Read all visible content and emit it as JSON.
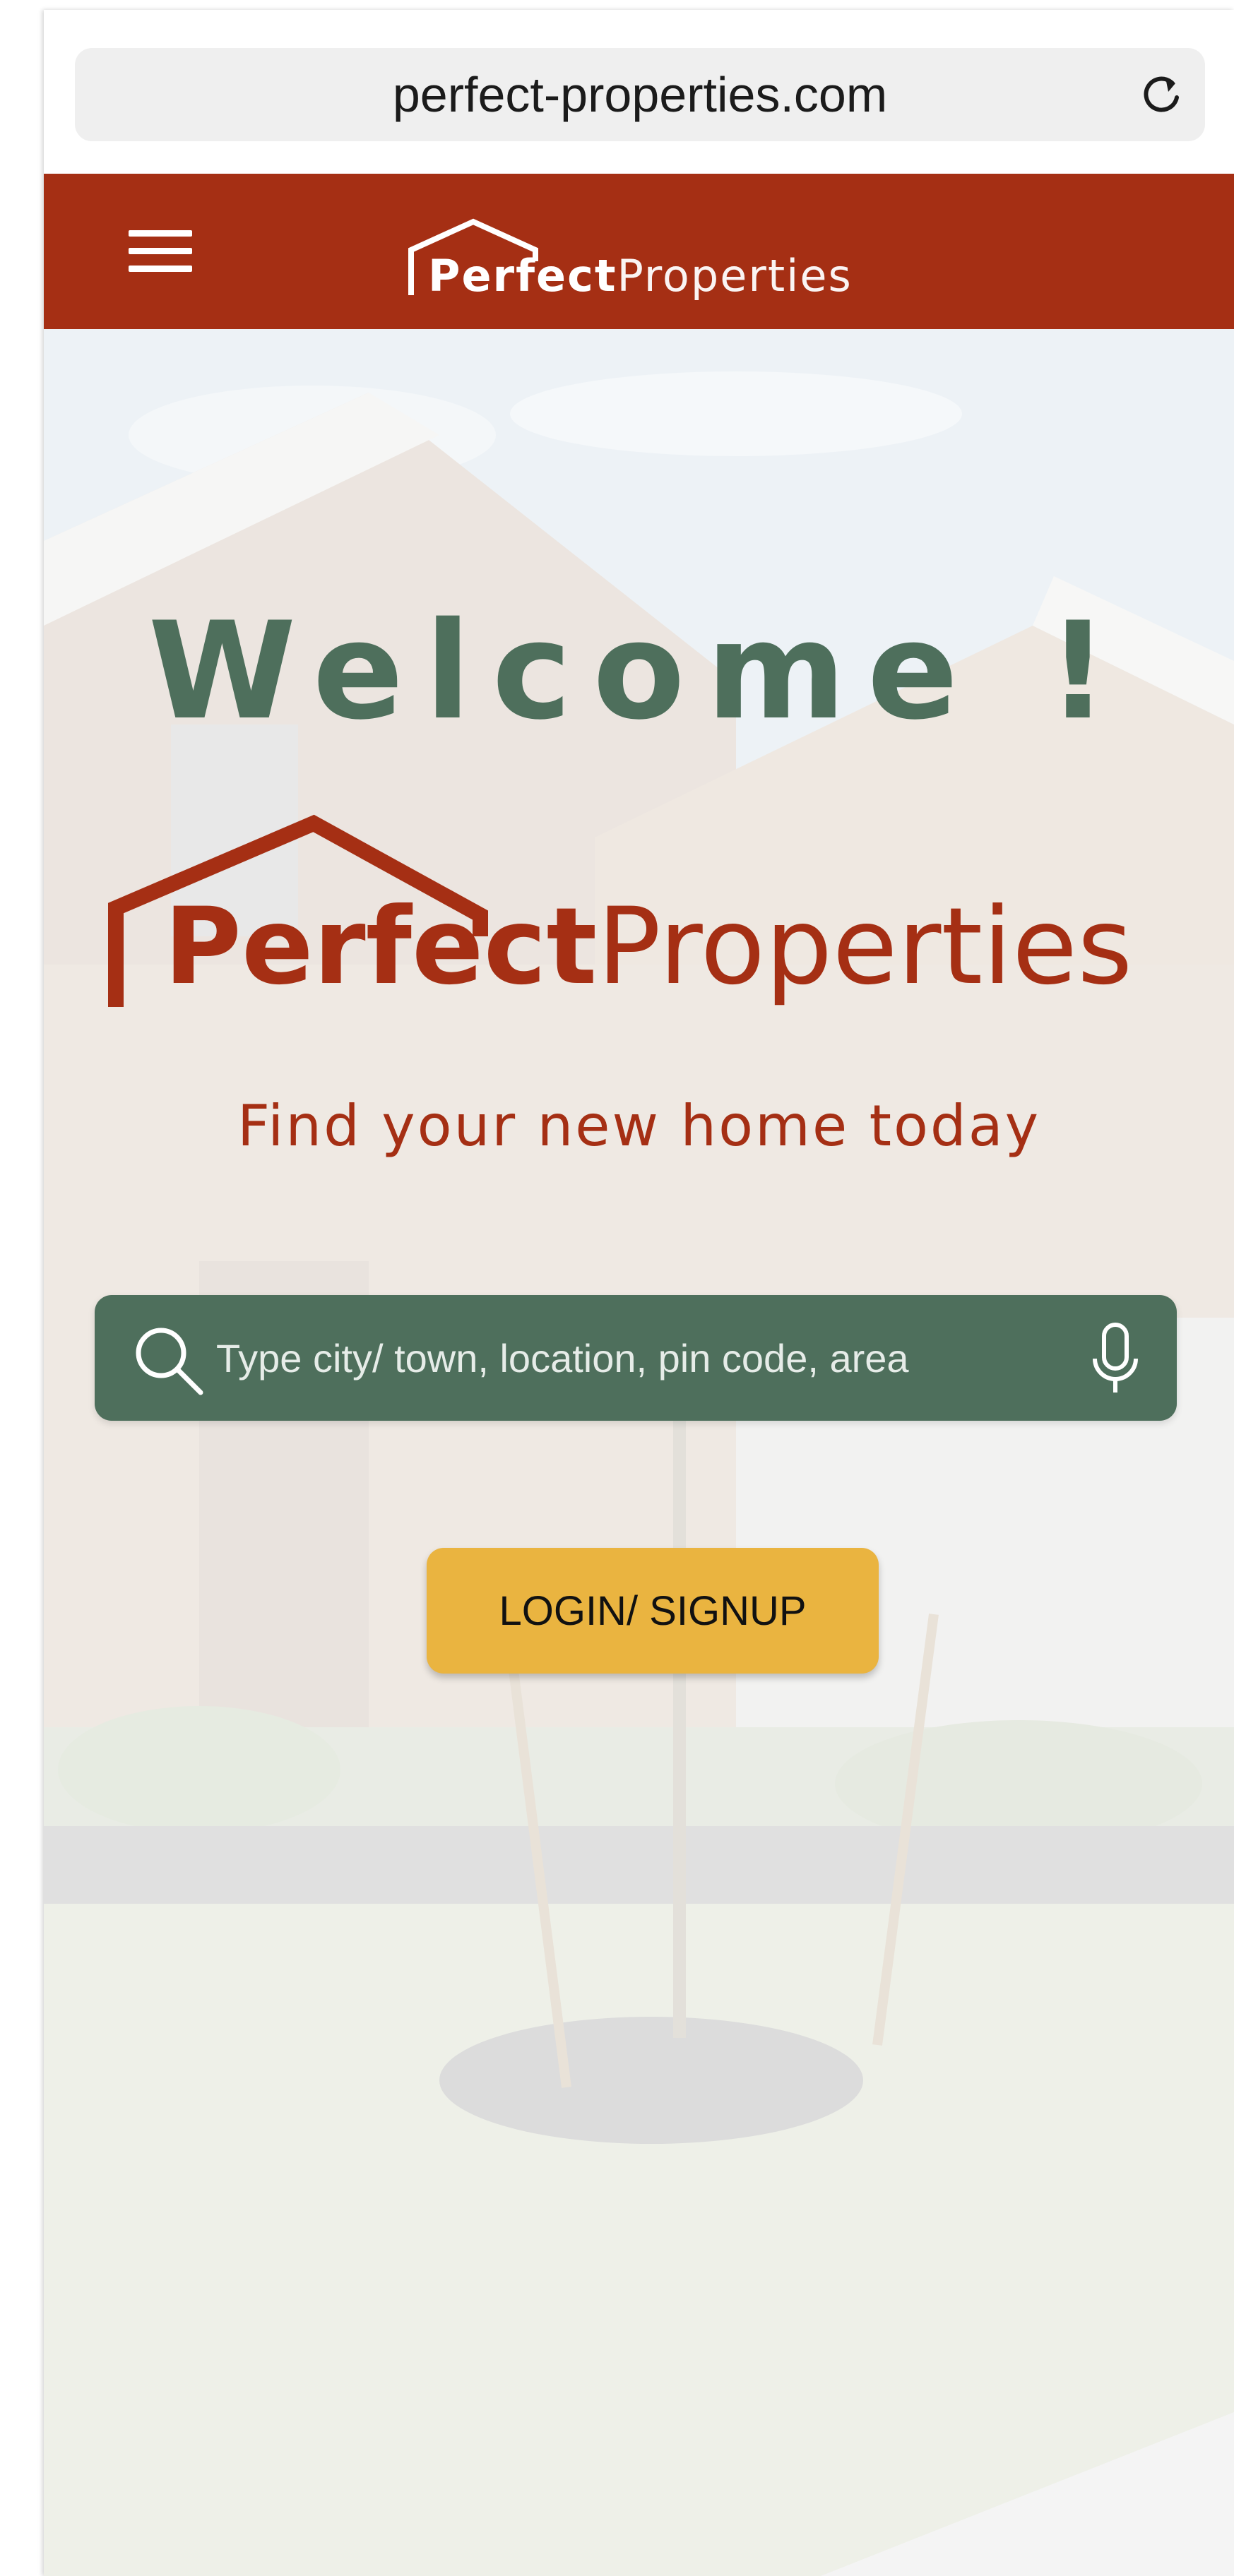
{
  "browser": {
    "url": "perfect-properties.com",
    "reload_icon": "reload-icon"
  },
  "navbar": {
    "menu_icon": "hamburger-menu-icon",
    "logo_bold": "Perfect",
    "logo_light": "Properties",
    "background_color": "#a52f14"
  },
  "hero": {
    "welcome": "Welcome !",
    "logo_bold": "Perfect",
    "logo_light": "Properties",
    "tagline": "Find your new home today",
    "background_image": "house-photo"
  },
  "search": {
    "placeholder": "Type city/ town, location, pin code, area",
    "search_icon": "search-icon",
    "mic_icon": "microphone-icon",
    "background_color": "#4e6f5c"
  },
  "login": {
    "label": "LOGIN/ SIGNUP",
    "background_color": "#eab440"
  },
  "colors": {
    "brand_red": "#a52f14",
    "brand_green": "#4e6f5c",
    "accent_yellow": "#eab440"
  }
}
